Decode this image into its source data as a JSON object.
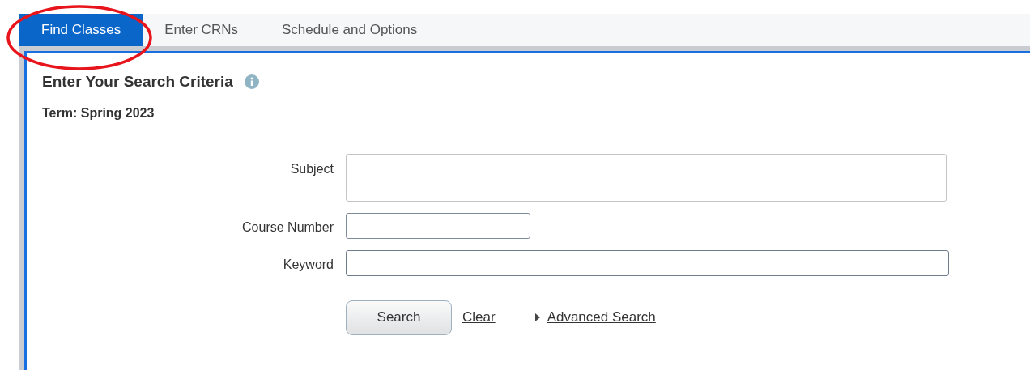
{
  "tabs": [
    {
      "label": "Find Classes",
      "selected": true
    },
    {
      "label": "Enter CRNs",
      "selected": false
    },
    {
      "label": "Schedule and Options",
      "selected": false
    }
  ],
  "annotation": {
    "circled_tab": true
  },
  "panel": {
    "title": "Enter Your Search Criteria",
    "term": "Term: Spring 2023"
  },
  "fields": [
    {
      "label": "Subject",
      "kind": "multi"
    },
    {
      "label": "Course Number",
      "kind": "short"
    },
    {
      "label": "Keyword",
      "kind": "long"
    }
  ],
  "actions": {
    "search": "Search",
    "clear": "Clear",
    "advanced": "Advanced Search"
  }
}
